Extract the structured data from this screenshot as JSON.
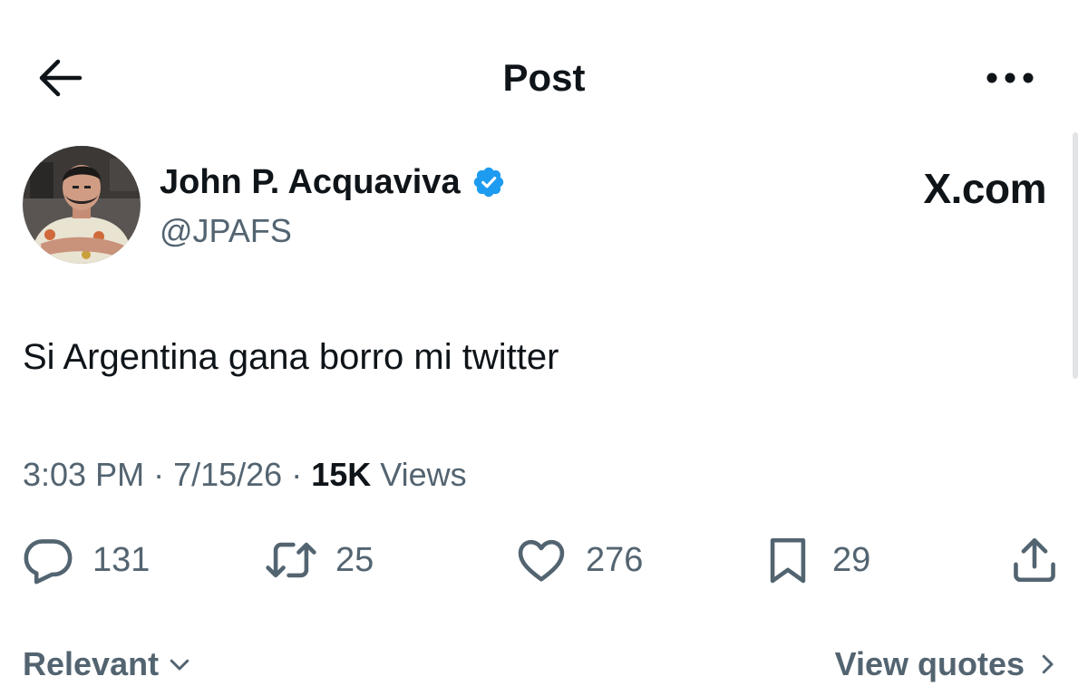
{
  "header": {
    "title": "Post"
  },
  "author": {
    "name": "John P. Acquaviva",
    "handle": "@JPAFS",
    "verified": true
  },
  "watermark": "X.com",
  "tweet": {
    "text": "Si Argentina gana borro mi twitter",
    "time": "3:03 PM",
    "date": "7/15/26",
    "views_count": "15K",
    "views_label": "Views"
  },
  "actions": {
    "replies": "131",
    "reposts": "25",
    "likes": "276",
    "bookmarks": "29"
  },
  "footer": {
    "sort_label": "Relevant",
    "quotes_label": "View quotes"
  },
  "colors": {
    "text": "#0f1419",
    "secondary": "#536471",
    "verified": "#1d9bf0"
  },
  "icons": [
    "back-arrow-icon",
    "more-icon",
    "verified-badge-icon",
    "reply-icon",
    "repost-icon",
    "like-icon",
    "bookmark-icon",
    "share-icon",
    "chevron-down-icon",
    "chevron-right-icon"
  ]
}
